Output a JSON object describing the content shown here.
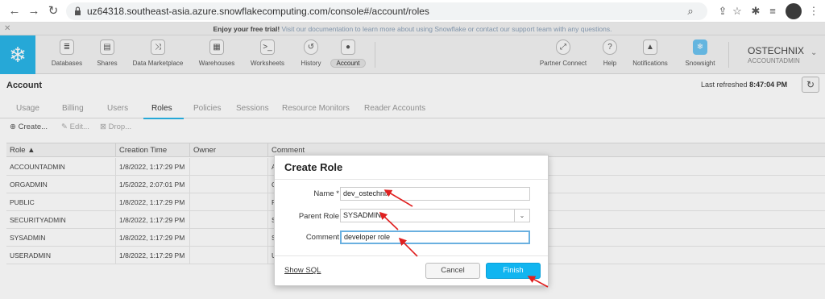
{
  "browser": {
    "url": "uz64318.southeast-asia.azure.snowflakecomputing.com/console#/account/roles"
  },
  "banner": {
    "bold": "Enjoy your free trial!",
    "rest": "Visit our documentation to learn more about using Snowflake or contact our support team with any questions."
  },
  "toolbar": {
    "items": [
      {
        "label": "Databases",
        "icon": "database-icon"
      },
      {
        "label": "Shares",
        "icon": "shares-icon"
      },
      {
        "label": "Data Marketplace",
        "icon": "shuffle-icon"
      },
      {
        "label": "Warehouses",
        "icon": "grid-icon"
      },
      {
        "label": "Worksheets",
        "icon": "terminal-icon"
      },
      {
        "label": "History",
        "icon": "history-icon"
      },
      {
        "label": "Account",
        "icon": "person-icon"
      }
    ],
    "right_items": [
      {
        "label": "Partner Connect",
        "icon": "link-icon"
      },
      {
        "label": "Help",
        "icon": "help-icon"
      },
      {
        "label": "Notifications",
        "icon": "bell-icon"
      },
      {
        "label": "Snowsight",
        "icon": "snowflake-icon"
      }
    ],
    "user": {
      "name": "OSTECHNIX",
      "role": "ACCOUNTADMIN"
    }
  },
  "page": {
    "title": "Account",
    "refresh_label": "Last refreshed",
    "refresh_time": "8:47:04 PM"
  },
  "tabs": [
    "Usage",
    "Billing",
    "Users",
    "Roles",
    "Policies",
    "Sessions",
    "Resource Monitors",
    "Reader Accounts"
  ],
  "actions": {
    "create": "Create...",
    "edit": "Edit...",
    "drop": "Drop..."
  },
  "table": {
    "headers": [
      "Role ▲",
      "Creation Time",
      "Owner",
      "Comment"
    ],
    "rows": [
      {
        "role": "ACCOUNTADMIN",
        "time": "1/8/2022, 1:17:29 PM",
        "owner": "",
        "comment": "A"
      },
      {
        "role": "ORGADMIN",
        "time": "1/5/2022, 2:07:01 PM",
        "owner": "",
        "comment": "O"
      },
      {
        "role": "PUBLIC",
        "time": "1/8/2022, 1:17:29 PM",
        "owner": "",
        "comment": "P"
      },
      {
        "role": "SECURITYADMIN",
        "time": "1/8/2022, 1:17:29 PM",
        "owner": "",
        "comment": "S"
      },
      {
        "role": "SYSADMIN",
        "time": "1/8/2022, 1:17:29 PM",
        "owner": "",
        "comment": "S"
      },
      {
        "role": "USERADMIN",
        "time": "1/8/2022, 1:17:29 PM",
        "owner": "",
        "comment": "U"
      }
    ]
  },
  "dialog": {
    "title": "Create Role",
    "name_label": "Name *",
    "name_value": "dev_ostechnix",
    "parent_label": "Parent Role",
    "parent_value": "SYSADMIN",
    "comment_label": "Comment",
    "comment_value": "developer role",
    "show_sql": "Show SQL",
    "cancel": "Cancel",
    "finish": "Finish"
  },
  "colors": {
    "accent": "#29b5e8",
    "finish": "#11b5f0",
    "annotation": "#e02020"
  }
}
